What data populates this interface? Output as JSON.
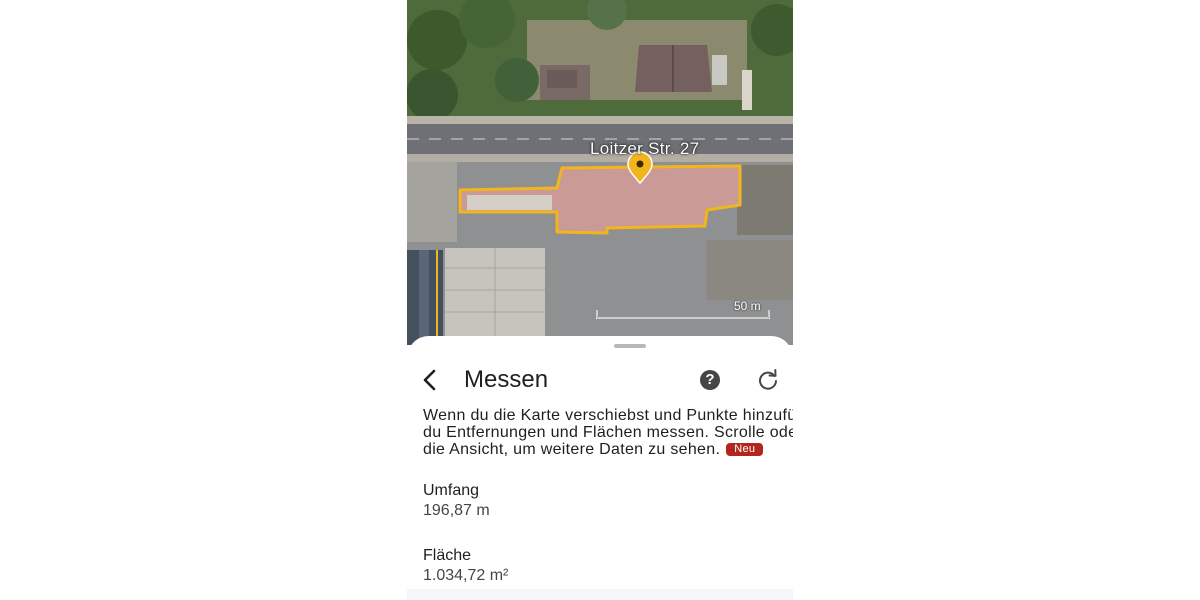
{
  "map": {
    "address_label": "Loitzer Str. 27",
    "scale_label": "50 m",
    "outline_color": "#f2b51d",
    "pin_color": "#f2b51d"
  },
  "panel": {
    "title": "Messen",
    "back_icon": "chevron-left-icon",
    "help_icon": "help-circle-icon",
    "reset_icon": "refresh-icon",
    "description_lines": [
      "Wenn du die Karte verschiebst und Punkte hinzufügst, k",
      "du Entfernungen und Flächen messen. Scrolle oder max",
      "die Ansicht, um weitere Daten zu sehen."
    ],
    "badge_label": "Neu",
    "badge_color": "#b3261e",
    "perimeter": {
      "label": "Umfang",
      "value": "196,87 m"
    },
    "area": {
      "label": "Fläche",
      "value": "1.034,72 m²"
    }
  }
}
